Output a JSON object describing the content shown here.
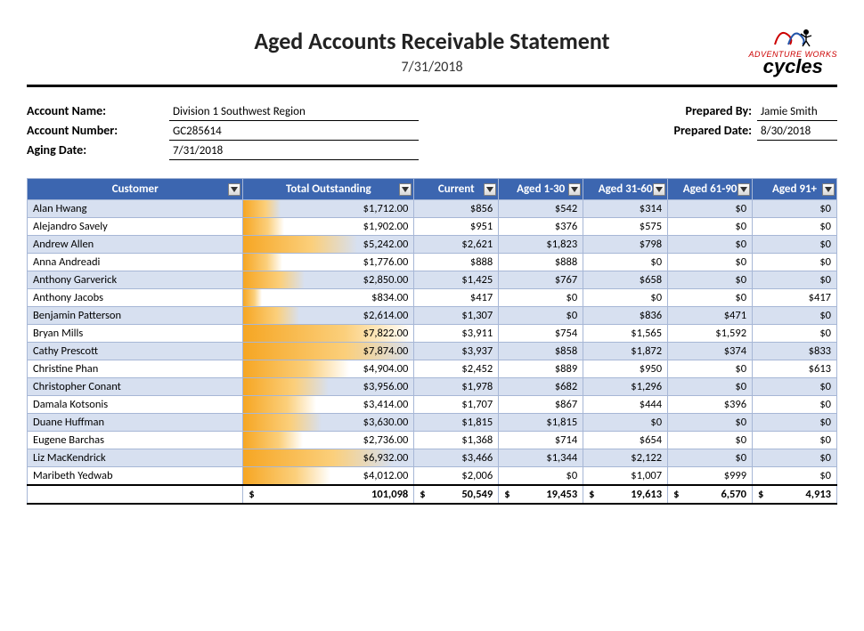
{
  "header": {
    "title": "Aged Accounts Receivable Statement",
    "date": "7/31/2018",
    "brand_small": "ADVENTURE WORKS",
    "brand_big": "cycles"
  },
  "info": {
    "account_name_label": "Account Name:",
    "account_name": "Division 1 Southwest Region",
    "account_number_label": "Account Number:",
    "account_number": "GC285614",
    "aging_date_label": "Aging Date:",
    "aging_date": "7/31/2018",
    "prepared_by_label": "Prepared By:",
    "prepared_by": "Jamie Smith",
    "prepared_date_label": "Prepared Date:",
    "prepared_date": "8/30/2018"
  },
  "columns": {
    "customer": "Customer",
    "total": "Total Outstanding",
    "current": "Current",
    "a1_30": "Aged 1-30",
    "a31_60": "Aged 31-60",
    "a61_90": "Aged 61-90",
    "a91": "Aged 91+"
  },
  "rows": [
    {
      "customer": "Alan Hwang",
      "total": "$1,712.00",
      "bar": 0.22,
      "current": "$856",
      "a1": "$542",
      "a2": "$314",
      "a3": "$0",
      "a4": "$0"
    },
    {
      "customer": "Alejandro Savely",
      "total": "$1,902.00",
      "bar": 0.24,
      "current": "$951",
      "a1": "$376",
      "a2": "$575",
      "a3": "$0",
      "a4": "$0"
    },
    {
      "customer": "Andrew Allen",
      "total": "$5,242.00",
      "bar": 0.67,
      "current": "$2,621",
      "a1": "$1,823",
      "a2": "$798",
      "a3": "$0",
      "a4": "$0"
    },
    {
      "customer": "Anna Andreadi",
      "total": "$1,776.00",
      "bar": 0.23,
      "current": "$888",
      "a1": "$888",
      "a2": "$0",
      "a3": "$0",
      "a4": "$0"
    },
    {
      "customer": "Anthony Garverick",
      "total": "$2,850.00",
      "bar": 0.36,
      "current": "$1,425",
      "a1": "$767",
      "a2": "$658",
      "a3": "$0",
      "a4": "$0"
    },
    {
      "customer": "Anthony Jacobs",
      "total": "$834.00",
      "bar": 0.11,
      "current": "$417",
      "a1": "$0",
      "a2": "$0",
      "a3": "$0",
      "a4": "$417"
    },
    {
      "customer": "Benjamin Patterson",
      "total": "$2,614.00",
      "bar": 0.33,
      "current": "$1,307",
      "a1": "$0",
      "a2": "$836",
      "a3": "$471",
      "a4": "$0"
    },
    {
      "customer": "Bryan Mills",
      "total": "$7,822.00",
      "bar": 0.99,
      "current": "$3,911",
      "a1": "$754",
      "a2": "$1,565",
      "a3": "$1,592",
      "a4": "$0"
    },
    {
      "customer": "Cathy Prescott",
      "total": "$7,874.00",
      "bar": 1.0,
      "current": "$3,937",
      "a1": "$858",
      "a2": "$1,872",
      "a3": "$374",
      "a4": "$833"
    },
    {
      "customer": "Christine Phan",
      "total": "$4,904.00",
      "bar": 0.62,
      "current": "$2,452",
      "a1": "$889",
      "a2": "$950",
      "a3": "$0",
      "a4": "$613"
    },
    {
      "customer": "Christopher Conant",
      "total": "$3,956.00",
      "bar": 0.5,
      "current": "$1,978",
      "a1": "$682",
      "a2": "$1,296",
      "a3": "$0",
      "a4": "$0"
    },
    {
      "customer": "Damala Kotsonis",
      "total": "$3,414.00",
      "bar": 0.43,
      "current": "$1,707",
      "a1": "$867",
      "a2": "$444",
      "a3": "$396",
      "a4": "$0"
    },
    {
      "customer": "Duane Huffman",
      "total": "$3,630.00",
      "bar": 0.46,
      "current": "$1,815",
      "a1": "$1,815",
      "a2": "$0",
      "a3": "$0",
      "a4": "$0"
    },
    {
      "customer": "Eugene Barchas",
      "total": "$2,736.00",
      "bar": 0.35,
      "current": "$1,368",
      "a1": "$714",
      "a2": "$654",
      "a3": "$0",
      "a4": "$0"
    },
    {
      "customer": "Liz MacKendrick",
      "total": "$6,932.00",
      "bar": 0.88,
      "current": "$3,466",
      "a1": "$1,344",
      "a2": "$2,122",
      "a3": "$0",
      "a4": "$0"
    },
    {
      "customer": "Maribeth Yedwab",
      "total": "$4,012.00",
      "bar": 0.51,
      "current": "$2,006",
      "a1": "$0",
      "a2": "$1,007",
      "a3": "$999",
      "a4": "$0"
    }
  ],
  "totals": {
    "total": "101,098",
    "current": "50,549",
    "a1": "19,453",
    "a2": "19,613",
    "a3": "6,570",
    "a4": "4,913"
  }
}
